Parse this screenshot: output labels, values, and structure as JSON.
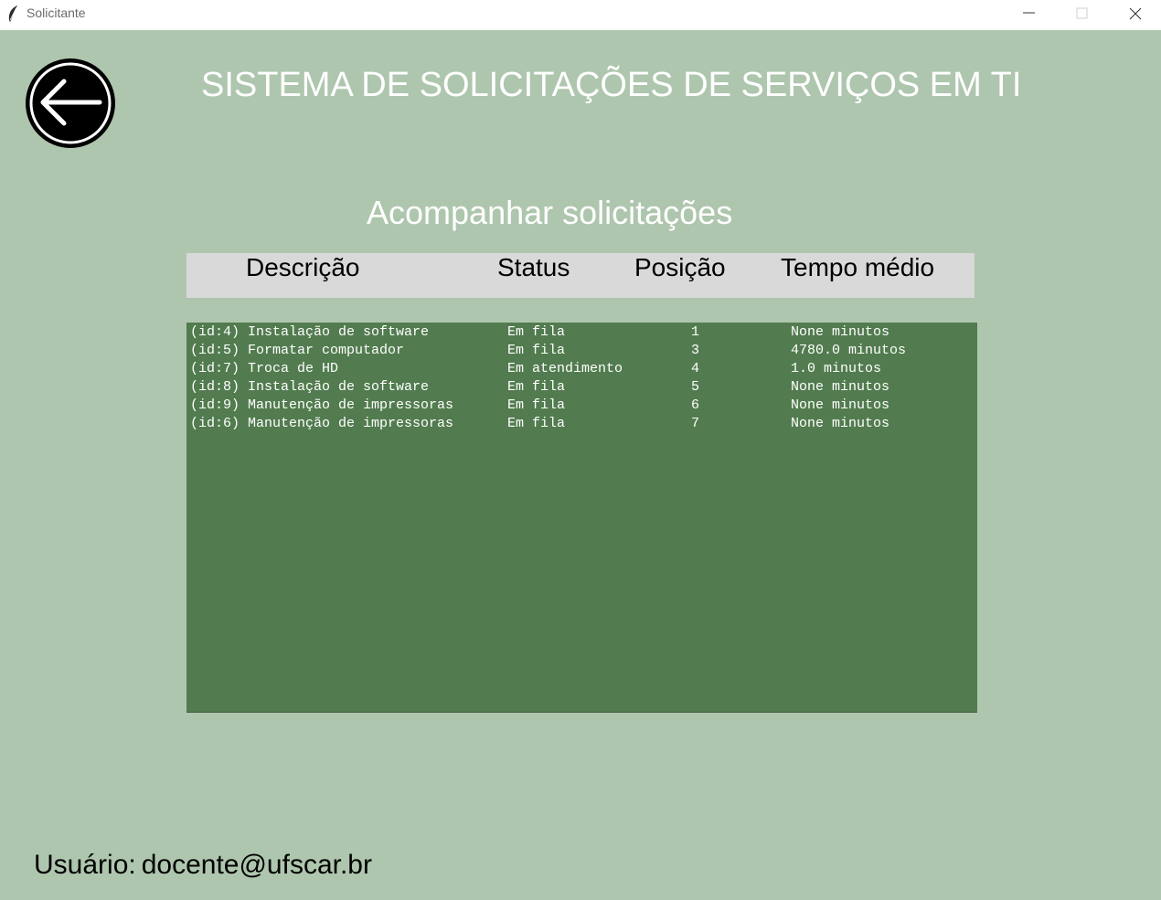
{
  "window": {
    "title": "Solicitante",
    "icon": "feather-icon"
  },
  "app_title": "SISTEMA DE SOLICITAÇÕES DE SERVIÇOS EM TI",
  "section_title": "Acompanhar solicitações",
  "back_button": {
    "icon": "back-arrow-icon"
  },
  "table": {
    "headers": {
      "descricao": "Descrição",
      "status": "Status",
      "posicao": "Posição",
      "tempo": "Tempo médio"
    },
    "rows": [
      {
        "descricao": "(id:4) Instalação de software",
        "status": "Em fila",
        "posicao": "1",
        "tempo": "None minutos"
      },
      {
        "descricao": "(id:5) Formatar computador",
        "status": "Em fila",
        "posicao": "3",
        "tempo": "4780.0 minutos"
      },
      {
        "descricao": "(id:7) Troca de HD",
        "status": "Em atendimento",
        "posicao": "4",
        "tempo": "1.0 minutos"
      },
      {
        "descricao": "(id:8) Instalação de software",
        "status": "Em fila",
        "posicao": "5",
        "tempo": "None minutos"
      },
      {
        "descricao": "(id:9) Manutenção de impressoras",
        "status": "Em fila",
        "posicao": "6",
        "tempo": "None minutos"
      },
      {
        "descricao": "(id:6) Manutenção de impressoras",
        "status": "Em fila",
        "posicao": "7",
        "tempo": "None minutos"
      }
    ]
  },
  "user": {
    "label": "Usuário:",
    "email": "docente@ufscar.br"
  },
  "colors": {
    "background": "#aec6ae",
    "listbox": "#527c4f",
    "header_bar": "#d9d9d9"
  }
}
